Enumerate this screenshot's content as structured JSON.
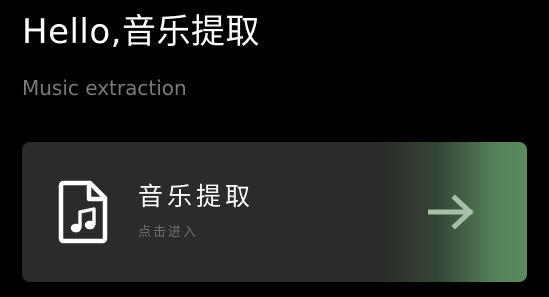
{
  "header": {
    "title": "Hello,音乐提取",
    "subtitle": "Music extraction"
  },
  "card": {
    "title": "音乐提取",
    "subtitle": "点击进入",
    "icon": "music-file-icon",
    "action_icon": "arrow-right-icon",
    "accent_color": "#5a8a5e",
    "background_color": "#2b2b2b"
  }
}
